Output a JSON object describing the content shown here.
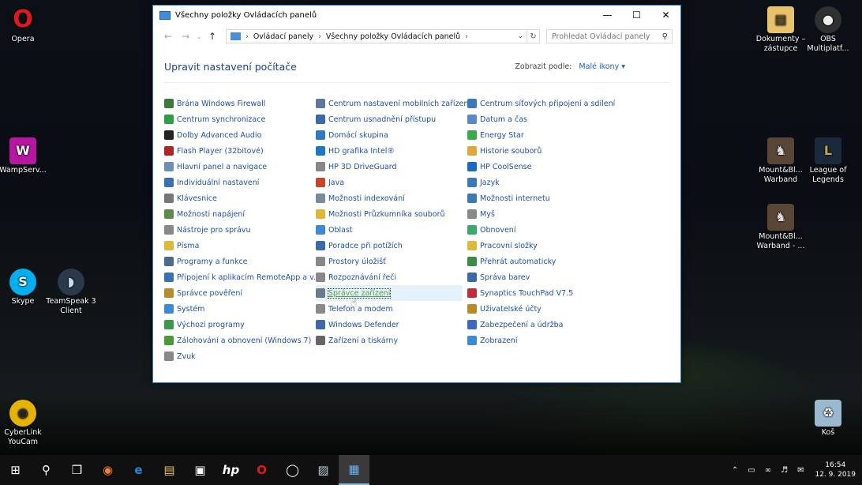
{
  "desktop": {
    "left_icons": [
      {
        "label": "Opera",
        "icon": "opera-icon",
        "color": "#cc0f16"
      },
      {
        "label": "WampServ...",
        "icon": "wampserver-icon",
        "color": "#b5179e"
      },
      {
        "label": "Skype",
        "icon": "skype-icon",
        "color": "#00aff0"
      },
      {
        "label": "TeamSpeak 3 Client",
        "icon": "teamspeak-icon",
        "color": "#2a3a4a"
      },
      {
        "label": "CyberLink YouCam",
        "icon": "youcam-icon",
        "color": "#e6b400"
      }
    ],
    "right_icons": [
      {
        "label": "Dokumenty – zástupce",
        "icon": "folder-shortcut-icon",
        "color": "#e8c36a"
      },
      {
        "label": "OBS Multiplatf...",
        "icon": "obs-icon",
        "color": "#303030"
      },
      {
        "label": "Mount&Bl... Warband",
        "icon": "mount-blade-icon",
        "color": "#5a4636"
      },
      {
        "label": "League of Legends",
        "icon": "league-icon",
        "color": "#c7a54a"
      },
      {
        "label": "Mount&Bl... Warband - ...",
        "icon": "mount-blade-icon",
        "color": "#5a4636"
      },
      {
        "label": "Koš",
        "icon": "recycle-bin-icon",
        "color": "#9ab8d0"
      }
    ]
  },
  "window": {
    "title": "Všechny položky Ovládacích panelů",
    "address": {
      "seg1": "Ovládací panely",
      "seg2": "Všechny položky Ovládacích panelů"
    },
    "search_placeholder": "Prohledat Ovládací panely",
    "page_title": "Upravit nastavení počítače",
    "view_by_label": "Zobrazit podle:",
    "view_by_value": "Malé ikony ▾",
    "columns": [
      [
        {
          "label": "Brána Windows Firewall",
          "icon": "firewall-icon",
          "color": "#3d7a3a"
        },
        {
          "label": "Centrum synchronizace",
          "icon": "sync-icon",
          "color": "#2ea043"
        },
        {
          "label": "Dolby Advanced Audio",
          "icon": "dolby-icon",
          "color": "#222"
        },
        {
          "label": "Flash Player (32bitové)",
          "icon": "flash-icon",
          "color": "#b1261e"
        },
        {
          "label": "Hlavní panel a navigace",
          "icon": "taskbar-icon",
          "color": "#6b8fb5"
        },
        {
          "label": "Individuální nastavení",
          "icon": "personalization-icon",
          "color": "#3b6fb6"
        },
        {
          "label": "Klávesnice",
          "icon": "keyboard-icon",
          "color": "#777"
        },
        {
          "label": "Možnosti napájení",
          "icon": "power-icon",
          "color": "#5e8a4a"
        },
        {
          "label": "Nástroje pro správu",
          "icon": "admin-tools-icon",
          "color": "#888"
        },
        {
          "label": "Písma",
          "icon": "fonts-icon",
          "color": "#e0b838"
        },
        {
          "label": "Programy a funkce",
          "icon": "programs-icon",
          "color": "#4a6b8a"
        },
        {
          "label": "Připojení k aplikacím RemoteApp a v...",
          "icon": "remoteapp-icon",
          "color": "#3a70b5"
        },
        {
          "label": "Správce pověření",
          "icon": "credential-icon",
          "color": "#b88a2a"
        },
        {
          "label": "Systém",
          "icon": "system-icon",
          "color": "#3b8ad6"
        },
        {
          "label": "Výchozí programy",
          "icon": "default-programs-icon",
          "color": "#3a9a4a"
        },
        {
          "label": "Zálohování a obnovení (Windows 7)",
          "icon": "backup-icon",
          "color": "#4a9a3a"
        },
        {
          "label": "Zvuk",
          "icon": "sound-icon",
          "color": "#888"
        }
      ],
      [
        {
          "label": "Centrum nastavení mobilních zařízení",
          "icon": "mobility-icon",
          "color": "#5a7a9a"
        },
        {
          "label": "Centrum usnadnění přístupu",
          "icon": "ease-of-access-icon",
          "color": "#3a6aa8"
        },
        {
          "label": "Domácí skupina",
          "icon": "homegroup-icon",
          "color": "#2e7bc4"
        },
        {
          "label": "HD grafika Intel®",
          "icon": "intel-graphics-icon",
          "color": "#1a7ac4"
        },
        {
          "label": "HP 3D DriveGuard",
          "icon": "hp-driveguard-icon",
          "color": "#888"
        },
        {
          "label": "Java",
          "icon": "java-icon",
          "color": "#c8452a"
        },
        {
          "label": "Možnosti indexování",
          "icon": "indexing-icon",
          "color": "#7a8a9a"
        },
        {
          "label": "Možnosti Průzkumníka souborů",
          "icon": "explorer-options-icon",
          "color": "#e0b838"
        },
        {
          "label": "Oblast",
          "icon": "region-icon",
          "color": "#3a8ad6"
        },
        {
          "label": "Poradce při potížích",
          "icon": "troubleshoot-icon",
          "color": "#3a6aa8"
        },
        {
          "label": "Prostory úložišť",
          "icon": "storage-spaces-icon",
          "color": "#888"
        },
        {
          "label": "Rozpoznávání řeči",
          "icon": "speech-icon",
          "color": "#888"
        },
        {
          "label": "Správce zařízení",
          "icon": "device-manager-icon",
          "color": "#6a7a8a"
        },
        {
          "label": "Telefon a modem",
          "icon": "phone-modem-icon",
          "color": "#888"
        },
        {
          "label": "Windows Defender",
          "icon": "defender-icon",
          "color": "#3a6aa8"
        },
        {
          "label": "Zařízení a tiskárny",
          "icon": "printers-icon",
          "color": "#666"
        }
      ],
      [
        {
          "label": "Centrum síťových připojení a sdílení",
          "icon": "network-center-icon",
          "color": "#3a7ab8"
        },
        {
          "label": "Datum a čas",
          "icon": "date-time-icon",
          "color": "#5a8ac6"
        },
        {
          "label": "Energy Star",
          "icon": "energy-star-icon",
          "color": "#3aaa4a"
        },
        {
          "label": "Historie souborů",
          "icon": "file-history-icon",
          "color": "#e0a838"
        },
        {
          "label": "HP CoolSense",
          "icon": "hp-coolsense-icon",
          "color": "#1a6ac4"
        },
        {
          "label": "Jazyk",
          "icon": "language-icon",
          "color": "#3a7ab8"
        },
        {
          "label": "Možnosti internetu",
          "icon": "internet-options-icon",
          "color": "#3a7ab8"
        },
        {
          "label": "Myš",
          "icon": "mouse-icon",
          "color": "#888"
        },
        {
          "label": "Obnovení",
          "icon": "recovery-icon",
          "color": "#3aaa6a"
        },
        {
          "label": "Pracovní složky",
          "icon": "work-folders-icon",
          "color": "#e0b838"
        },
        {
          "label": "Přehrát automaticky",
          "icon": "autoplay-icon",
          "color": "#3a8a4a"
        },
        {
          "label": "Správa barev",
          "icon": "color-management-icon",
          "color": "#3a6aa8"
        },
        {
          "label": "Synaptics TouchPad V7.5",
          "icon": "synaptics-icon",
          "color": "#c42a3a"
        },
        {
          "label": "Uživatelské účty",
          "icon": "user-accounts-icon",
          "color": "#b88a2a"
        },
        {
          "label": "Zabezpečení a údržba",
          "icon": "security-maintenance-icon",
          "color": "#3a6ac4"
        },
        {
          "label": "Zobrazení",
          "icon": "display-icon",
          "color": "#3a8ad6"
        }
      ]
    ]
  },
  "taskbar": {
    "time": "16:54",
    "date": "12. 9. 2019"
  }
}
